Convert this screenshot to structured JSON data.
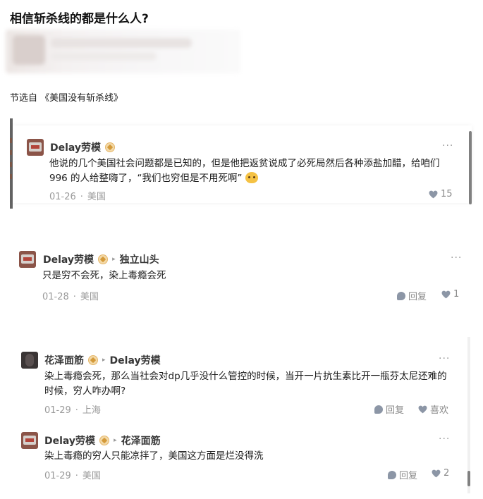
{
  "page": {
    "title": "相信斩杀线的都是什么人?",
    "source": "节选自 《美国没有斩杀线》"
  },
  "comments": [
    {
      "user": "Delay劳模",
      "reply_to": "",
      "text": "他说的几个美国社会问题都是已知的，但是他把返贫说成了必死局然后各种添盐加醋，给咱们 996 的人给整嗨了，“我们也穷但是不用死啊”",
      "date": "01-26",
      "location": "美国",
      "reply_label": "",
      "like_count": "15",
      "more": "···"
    },
    {
      "user": "Delay劳模",
      "reply_to": "独立山头",
      "text": "只是穷不会死，染上毒瘾会死",
      "date": "01-28",
      "location": "美国",
      "reply_label": "回复",
      "like_count": "1",
      "more": "···"
    },
    {
      "user": "花泽面筋",
      "reply_to": "Delay劳模",
      "text": "染上毒瘾会死，那么当社会对dp几乎没什么管控的时候，当开一片抗生素比开一瓶芬太尼还难的时候，穷人咋办啊?",
      "date": "01-29",
      "location": "上海",
      "reply_label": "回复",
      "like_count": "喜欢",
      "more": "···"
    },
    {
      "user": "Delay劳模",
      "reply_to": "花泽面筋",
      "text": "染上毒瘾的穷人只能凉拌了，美国这方面是烂没得洗",
      "date": "01-29",
      "location": "美国",
      "reply_label": "回复",
      "like_count": "2",
      "more": "···"
    }
  ],
  "separator": "·",
  "icons": {
    "reply": "comment-bubble-icon",
    "like": "heart-icon",
    "badge": "level-badge-icon",
    "arrow": "reply-arrow-icon"
  },
  "colors": {
    "muted": "#9a9a9a",
    "icon": "#8c96a6",
    "badge": "#e6b76a"
  }
}
